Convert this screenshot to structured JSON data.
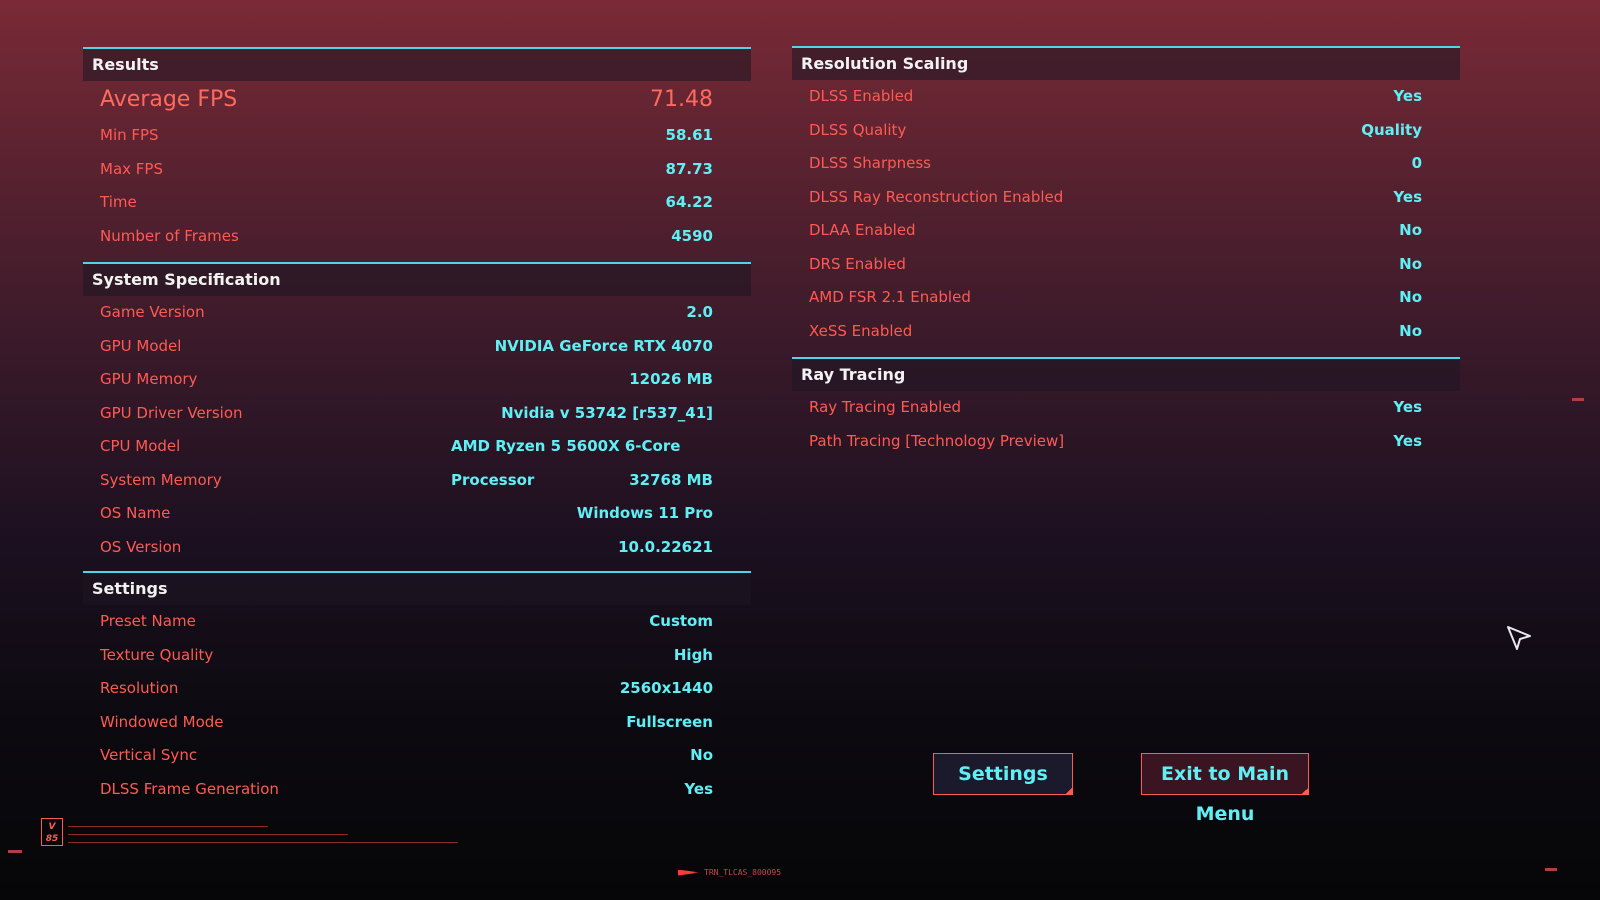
{
  "results": {
    "title": "Results",
    "rows": [
      {
        "label": "Average FPS",
        "value": "71.48"
      },
      {
        "label": "Min FPS",
        "value": "58.61"
      },
      {
        "label": "Max FPS",
        "value": "87.73"
      },
      {
        "label": "Time",
        "value": "64.22"
      },
      {
        "label": "Number of Frames",
        "value": "4590"
      }
    ]
  },
  "system": {
    "title": "System Specification",
    "rows": [
      {
        "label": "Game Version",
        "value": "2.0"
      },
      {
        "label": "GPU Model",
        "value": "NVIDIA GeForce RTX 4070"
      },
      {
        "label": "GPU Memory",
        "value": "12026 MB"
      },
      {
        "label": "GPU Driver Version",
        "value": "Nvidia v 53742 [r537_41]"
      },
      {
        "label": "CPU Model",
        "value": "AMD Ryzen 5 5600X 6-Core Processor"
      },
      {
        "label": "System Memory",
        "value": "32768 MB"
      },
      {
        "label": "OS Name",
        "value": "Windows 11 Pro"
      },
      {
        "label": "OS Version",
        "value": "10.0.22621"
      }
    ]
  },
  "settings": {
    "title": "Settings",
    "rows": [
      {
        "label": "Preset Name",
        "value": "Custom"
      },
      {
        "label": "Texture Quality",
        "value": "High"
      },
      {
        "label": "Resolution",
        "value": "2560x1440"
      },
      {
        "label": "Windowed Mode",
        "value": "Fullscreen"
      },
      {
        "label": "Vertical Sync",
        "value": "No"
      },
      {
        "label": "DLSS Frame Generation",
        "value": "Yes"
      }
    ]
  },
  "resolution_scaling": {
    "title": "Resolution Scaling",
    "rows": [
      {
        "label": "DLSS Enabled",
        "value": "Yes"
      },
      {
        "label": "DLSS Quality",
        "value": "Quality"
      },
      {
        "label": "DLSS Sharpness",
        "value": "0"
      },
      {
        "label": "DLSS Ray Reconstruction Enabled",
        "value": "Yes"
      },
      {
        "label": "DLAA Enabled",
        "value": "No"
      },
      {
        "label": "DRS Enabled",
        "value": "No"
      },
      {
        "label": "AMD FSR 2.1 Enabled",
        "value": "No"
      },
      {
        "label": "XeSS Enabled",
        "value": "No"
      }
    ]
  },
  "ray_tracing": {
    "title": "Ray Tracing",
    "rows": [
      {
        "label": "Ray Tracing Enabled",
        "value": "Yes"
      },
      {
        "label": "Path Tracing [Technology Preview]",
        "value": "Yes"
      }
    ]
  },
  "buttons": {
    "settings": "Settings",
    "exit": "Exit to Main Menu"
  },
  "footer": {
    "badge": "V 85",
    "code": "TRN_TLCAS_800095"
  },
  "icons": {
    "cursor": "pointer-cursor-icon",
    "badge": "v85-badge-icon"
  },
  "colors": {
    "label": "#ff5a52",
    "value": "#5ff0f5",
    "accent_line": "#4fd6e6"
  }
}
